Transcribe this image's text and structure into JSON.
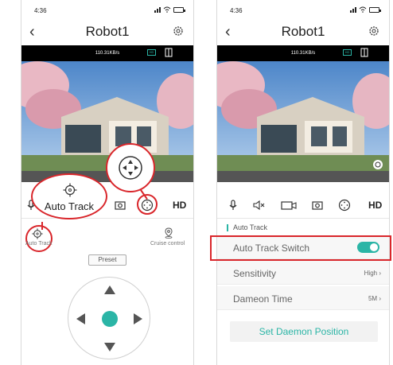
{
  "left_screen": {
    "status_time": "4:36",
    "title": "Robot1",
    "speed": "110.31KB/s",
    "hd_box": "HD",
    "toolbar_hd": "HD",
    "callout_label": "Auto Track",
    "auto_track_label": "Auto Track",
    "cruise_label": "Cruise control",
    "preset_label": "Preset"
  },
  "right_screen": {
    "status_time": "4:36",
    "title": "Robot1",
    "speed": "110.31KB/s",
    "hd_box": "HD",
    "toolbar_hd": "HD",
    "section_title": "Auto Track",
    "settings": [
      {
        "label": "Auto Track Switch",
        "value": "",
        "toggle_on": true
      },
      {
        "label": "Sensitivity",
        "value": "High"
      },
      {
        "label": "Dameon Time",
        "value": "5M"
      }
    ],
    "daemon_button": "Set Daemon Position"
  },
  "colors": {
    "accent": "#2bb5a6",
    "highlight": "#d9262b",
    "infobar": "#000000"
  },
  "icons": [
    "back-chevron-icon",
    "gear-icon",
    "microphone-icon",
    "mute-icon",
    "record-icon",
    "camera-icon",
    "ptz-icon",
    "target-icon",
    "location-pin-icon",
    "door-icon"
  ]
}
